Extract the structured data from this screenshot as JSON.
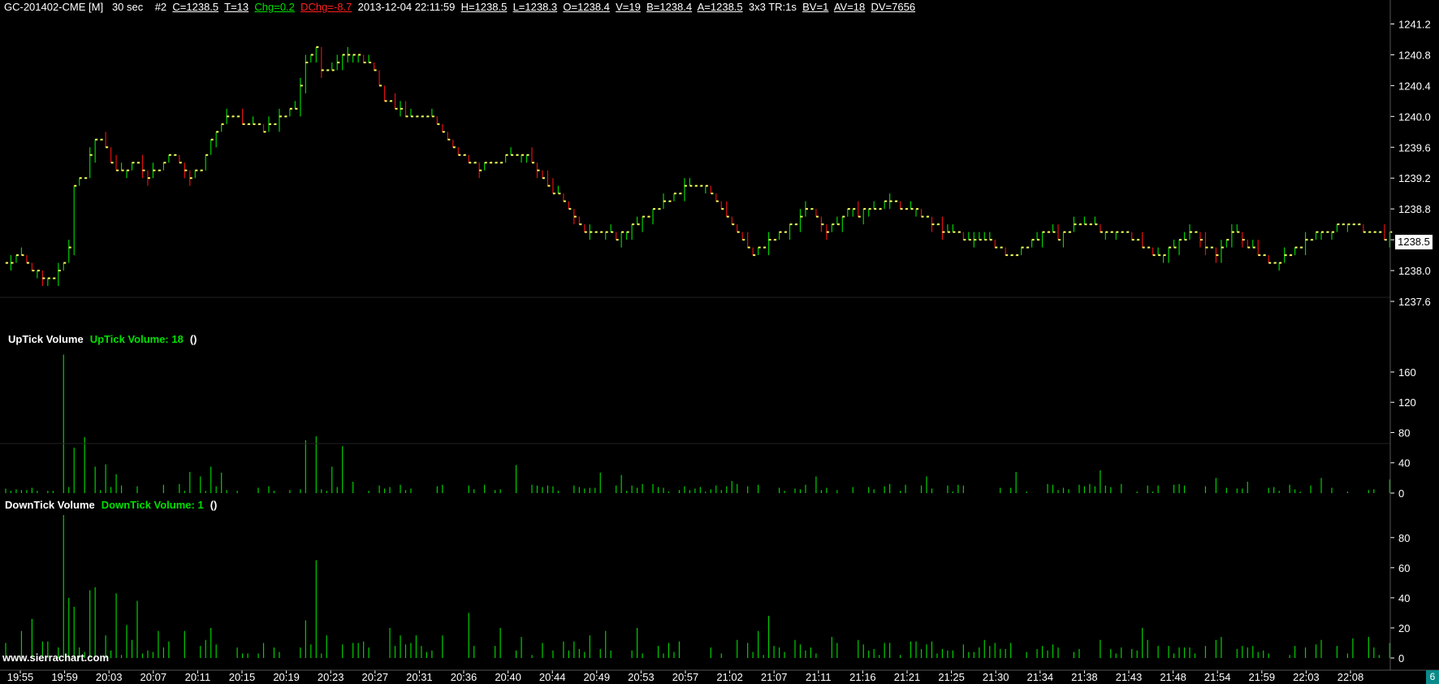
{
  "header": {
    "symbol": "GC-201402-CME [M]",
    "interval": "30 sec",
    "chart_num": "#2",
    "close": "C=1238.5",
    "trades": "T=13",
    "chg": "Chg=0.2",
    "dchg": "DChg=-8.7",
    "datetime": "2013-12-04 22:11:59",
    "high": "H=1238.5",
    "low": "L=1238.3",
    "open": "O=1238.4",
    "volume": "V=19",
    "bid": "B=1238.4",
    "ask": "A=1238.5",
    "misc": "3x3 TR:1s",
    "bv": "BV=1",
    "av": "AV=18",
    "dv": "DV=7656"
  },
  "uptick_panel": {
    "name": "UpTick Volume",
    "value_label": "UpTick Volume: 18",
    "extra": "()"
  },
  "downtick_panel": {
    "name": "DownTick Volume",
    "value_label": "DownTick Volume: 1",
    "extra": "()"
  },
  "last_price_label": "1238.5",
  "watermark": "www.sierrachart.com",
  "corner_label": "6",
  "colors": {
    "background": "#000000",
    "up_bar": "#00d000",
    "down_bar": "#e01010",
    "close_tick": "#ffff60",
    "volume": "#00d000",
    "text": "#ffffff"
  },
  "chart_data": [
    {
      "type": "ohlc",
      "title": "GC-201402-CME [M] 30 sec",
      "ylim": [
        1237.4,
        1241.3
      ],
      "yticks": [
        1237.6,
        1238.0,
        1238.4,
        1238.8,
        1239.2,
        1239.6,
        1240.0,
        1240.4,
        1240.8,
        1241.2
      ],
      "ytick_labels": [
        "1237.6",
        "1238.0",
        "1238.4",
        "1238.8",
        "1239.2",
        "1239.6",
        "1240.0",
        "1240.4",
        "1240.8",
        "1241.2"
      ],
      "xtick_labels": [
        "19:55",
        "19:59",
        "20:03",
        "20:07",
        "20:11",
        "20:15",
        "20:19",
        "20:23",
        "20:27",
        "20:31",
        "20:36",
        "20:40",
        "20:44",
        "20:49",
        "20:53",
        "20:57",
        "21:02",
        "21:07",
        "21:11",
        "21:16",
        "21:21",
        "21:25",
        "21:30",
        "21:34",
        "21:38",
        "21:43",
        "21:48",
        "21:54",
        "21:59",
        "22:03",
        "22:08"
      ],
      "close_path": [
        [
          0,
          1238.1
        ],
        [
          3,
          1238.2
        ],
        [
          5,
          1238.0
        ],
        [
          7,
          1237.9
        ],
        [
          9,
          1237.9
        ],
        [
          11,
          1238.1
        ],
        [
          12,
          1238.3
        ],
        [
          13,
          1239.1
        ],
        [
          15,
          1239.2
        ],
        [
          16,
          1239.5
        ],
        [
          17,
          1239.7
        ],
        [
          19,
          1239.6
        ],
        [
          21,
          1239.3
        ],
        [
          23,
          1239.3
        ],
        [
          25,
          1239.4
        ],
        [
          27,
          1239.2
        ],
        [
          29,
          1239.3
        ],
        [
          31,
          1239.5
        ],
        [
          33,
          1239.4
        ],
        [
          35,
          1239.2
        ],
        [
          37,
          1239.3
        ],
        [
          39,
          1239.7
        ],
        [
          41,
          1239.9
        ],
        [
          43,
          1240.0
        ],
        [
          45,
          1239.9
        ],
        [
          47,
          1239.9
        ],
        [
          49,
          1239.8
        ],
        [
          51,
          1239.9
        ],
        [
          53,
          1240.0
        ],
        [
          55,
          1240.1
        ],
        [
          57,
          1240.7
        ],
        [
          59,
          1240.9
        ],
        [
          60,
          1240.6
        ],
        [
          62,
          1240.6
        ],
        [
          64,
          1240.8
        ],
        [
          66,
          1240.8
        ],
        [
          68,
          1240.7
        ],
        [
          70,
          1240.6
        ],
        [
          72,
          1240.2
        ],
        [
          74,
          1240.1
        ],
        [
          76,
          1240.0
        ],
        [
          78,
          1240.0
        ],
        [
          80,
          1240.0
        ],
        [
          82,
          1239.9
        ],
        [
          84,
          1239.7
        ],
        [
          86,
          1239.5
        ],
        [
          88,
          1239.4
        ],
        [
          90,
          1239.3
        ],
        [
          92,
          1239.4
        ],
        [
          94,
          1239.4
        ],
        [
          96,
          1239.5
        ],
        [
          98,
          1239.5
        ],
        [
          100,
          1239.4
        ],
        [
          102,
          1239.2
        ],
        [
          104,
          1239.0
        ],
        [
          106,
          1238.9
        ],
        [
          108,
          1238.7
        ],
        [
          110,
          1238.5
        ],
        [
          112,
          1238.5
        ],
        [
          114,
          1238.5
        ],
        [
          116,
          1238.4
        ],
        [
          118,
          1238.5
        ],
        [
          120,
          1238.6
        ],
        [
          122,
          1238.7
        ],
        [
          124,
          1238.8
        ],
        [
          126,
          1238.9
        ],
        [
          128,
          1239.0
        ],
        [
          130,
          1239.1
        ],
        [
          132,
          1239.1
        ],
        [
          134,
          1239.0
        ],
        [
          136,
          1238.8
        ],
        [
          138,
          1238.6
        ],
        [
          140,
          1238.4
        ],
        [
          142,
          1238.2
        ],
        [
          144,
          1238.3
        ],
        [
          146,
          1238.4
        ],
        [
          148,
          1238.5
        ],
        [
          150,
          1238.6
        ],
        [
          152,
          1238.8
        ],
        [
          154,
          1238.7
        ],
        [
          156,
          1238.5
        ],
        [
          158,
          1238.6
        ],
        [
          160,
          1238.8
        ],
        [
          162,
          1238.7
        ],
        [
          164,
          1238.8
        ],
        [
          166,
          1238.8
        ],
        [
          168,
          1238.9
        ],
        [
          170,
          1238.8
        ],
        [
          172,
          1238.8
        ],
        [
          174,
          1238.7
        ],
        [
          176,
          1238.6
        ],
        [
          178,
          1238.5
        ],
        [
          180,
          1238.5
        ],
        [
          182,
          1238.4
        ],
        [
          184,
          1238.4
        ],
        [
          186,
          1238.4
        ],
        [
          188,
          1238.3
        ],
        [
          190,
          1238.2
        ],
        [
          192,
          1238.2
        ],
        [
          194,
          1238.3
        ],
        [
          196,
          1238.4
        ],
        [
          198,
          1238.5
        ],
        [
          200,
          1238.4
        ],
        [
          202,
          1238.5
        ],
        [
          204,
          1238.6
        ],
        [
          206,
          1238.6
        ],
        [
          208,
          1238.5
        ],
        [
          210,
          1238.5
        ],
        [
          212,
          1238.5
        ],
        [
          214,
          1238.4
        ],
        [
          216,
          1238.3
        ],
        [
          218,
          1238.2
        ],
        [
          220,
          1238.2
        ],
        [
          222,
          1238.3
        ],
        [
          224,
          1238.4
        ],
        [
          226,
          1238.5
        ],
        [
          228,
          1238.3
        ],
        [
          230,
          1238.2
        ],
        [
          232,
          1238.4
        ],
        [
          234,
          1238.5
        ],
        [
          236,
          1238.3
        ],
        [
          238,
          1238.2
        ],
        [
          240,
          1238.1
        ],
        [
          242,
          1238.1
        ],
        [
          244,
          1238.2
        ],
        [
          246,
          1238.3
        ],
        [
          248,
          1238.4
        ],
        [
          250,
          1238.5
        ],
        [
          252,
          1238.5
        ],
        [
          254,
          1238.6
        ],
        [
          256,
          1238.6
        ],
        [
          258,
          1238.5
        ],
        [
          260,
          1238.5
        ],
        [
          262,
          1238.4
        ],
        [
          263,
          1238.5
        ]
      ]
    },
    {
      "type": "bar",
      "name": "UpTick Volume",
      "ylim": [
        0,
        190
      ],
      "yticks": [
        0,
        40,
        80,
        120,
        160
      ],
      "ytick_labels": [
        "0",
        "40",
        "80",
        "120",
        "160"
      ],
      "last_value": 18,
      "spikes": [
        [
          11,
          183
        ],
        [
          13,
          60
        ],
        [
          15,
          74
        ],
        [
          17,
          35
        ],
        [
          19,
          38
        ],
        [
          21,
          25
        ],
        [
          33,
          12
        ],
        [
          35,
          28
        ],
        [
          37,
          22
        ],
        [
          39,
          35
        ],
        [
          41,
          27
        ],
        [
          57,
          70
        ],
        [
          59,
          75
        ],
        [
          62,
          35
        ],
        [
          64,
          62
        ],
        [
          66,
          15
        ],
        [
          97,
          37
        ],
        [
          113,
          27
        ],
        [
          117,
          24
        ],
        [
          123,
          12
        ],
        [
          135,
          10
        ],
        [
          138,
          16
        ],
        [
          154,
          22
        ],
        [
          175,
          22
        ],
        [
          192,
          28
        ],
        [
          208,
          30
        ],
        [
          223,
          12
        ],
        [
          230,
          20
        ],
        [
          236,
          15
        ],
        [
          250,
          20
        ],
        [
          263,
          18
        ]
      ],
      "baseline_range": [
        2,
        12
      ]
    },
    {
      "type": "bar",
      "name": "DownTick Volume",
      "ylim": [
        0,
        95
      ],
      "yticks": [
        0,
        20,
        40,
        60,
        80
      ],
      "ytick_labels": [
        "0",
        "20",
        "40",
        "60",
        "80"
      ],
      "last_value": 1,
      "spikes": [
        [
          3,
          18
        ],
        [
          5,
          26
        ],
        [
          11,
          95
        ],
        [
          12,
          40
        ],
        [
          13,
          34
        ],
        [
          16,
          45
        ],
        [
          17,
          47
        ],
        [
          19,
          15
        ],
        [
          21,
          43
        ],
        [
          23,
          22
        ],
        [
          25,
          38
        ],
        [
          29,
          18
        ],
        [
          34,
          18
        ],
        [
          39,
          20
        ],
        [
          57,
          25
        ],
        [
          59,
          65
        ],
        [
          61,
          15
        ],
        [
          73,
          20
        ],
        [
          75,
          15
        ],
        [
          78,
          15
        ],
        [
          83,
          15
        ],
        [
          88,
          30
        ],
        [
          94,
          20
        ],
        [
          98,
          14
        ],
        [
          111,
          15
        ],
        [
          114,
          18
        ],
        [
          120,
          20
        ],
        [
          126,
          10
        ],
        [
          143,
          18
        ],
        [
          145,
          28
        ],
        [
          150,
          12
        ],
        [
          157,
          14
        ],
        [
          168,
          10
        ],
        [
          186,
          12
        ],
        [
          216,
          20
        ],
        [
          231,
          14
        ],
        [
          250,
          12
        ],
        [
          256,
          13
        ],
        [
          259,
          14
        ]
      ],
      "baseline_range": [
        2,
        12
      ]
    }
  ]
}
